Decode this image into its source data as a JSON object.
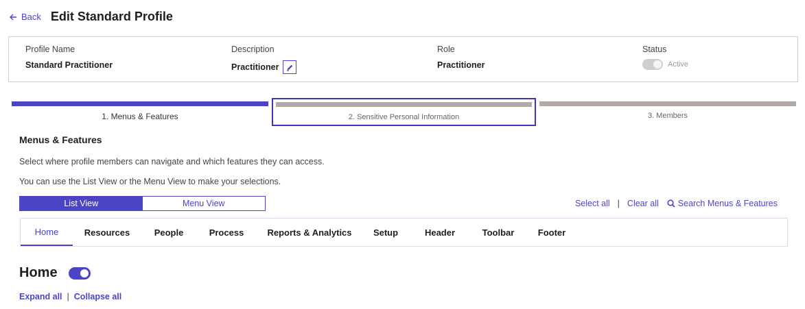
{
  "header": {
    "back_label": "Back",
    "title": "Edit Standard Profile"
  },
  "summary": {
    "profile_name_label": "Profile Name",
    "profile_name_value": "Standard Practitioner",
    "description_label": "Description",
    "description_value": "Practitioner",
    "role_label": "Role",
    "role_value": "Practitioner",
    "status_label": "Status",
    "status_value": "Active"
  },
  "steps": [
    {
      "label": "1. Menus & Features"
    },
    {
      "label": "2. Sensitive Personal Information"
    },
    {
      "label": "3. Members"
    }
  ],
  "section": {
    "title": "Menus & Features",
    "desc1": "Select where profile members can navigate and which features they can access.",
    "desc2": "You can use the List View or the Menu View to make your selections."
  },
  "views": {
    "list": "List View",
    "menu": "Menu View"
  },
  "actions": {
    "select_all": "Select all",
    "separator": "|",
    "clear_all": "Clear all",
    "search": "Search Menus & Features"
  },
  "tabs": [
    {
      "label": "Home"
    },
    {
      "label": "Resources"
    },
    {
      "label": "People"
    },
    {
      "label": "Process"
    },
    {
      "label": "Reports & Analytics"
    },
    {
      "label": "Setup"
    },
    {
      "label": "Header"
    },
    {
      "label": "Toolbar"
    },
    {
      "label": "Footer"
    }
  ],
  "home": {
    "title": "Home",
    "expand_all": "Expand all",
    "separator": "|",
    "collapse_all": "Collapse all"
  },
  "colors": {
    "accent": "#4b44c4",
    "inactive_step": "#b2aaa7"
  }
}
